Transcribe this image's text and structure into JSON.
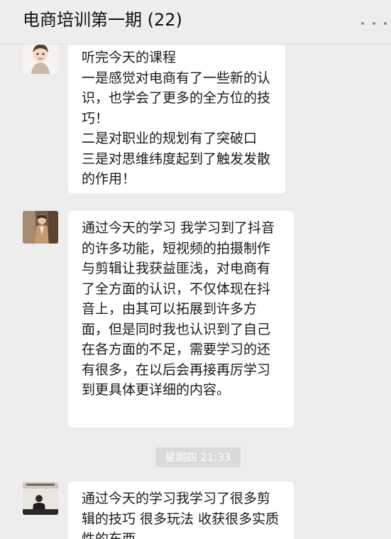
{
  "header": {
    "title": "电商培训第一期 (22)",
    "more_icon": "more-dots-icon"
  },
  "messages": [
    {
      "avatar": "avatar-cartoon-person",
      "text": "听完今天的课程\n一是感觉对电商有了一些新的认识，也学会了更多的全方位的技巧！\n二是对职业的规划有了突破口\n三是对思维纬度起到了触发发散的作用！"
    },
    {
      "avatar": "avatar-brown-coat-person",
      "text": "通过今天的学习  我学习到了抖音的许多功能，短视频的拍摄制作与剪辑让我获益匪浅，对电商有了全方面的认识，不仅体现在抖音上，由其可以拓展到许多方面，但是同时我也认识到了自己在各方面的不足，需要学习的还有很多，在以后会再接再厉学习到更具体更详细的内容。"
    },
    {
      "avatar": "avatar-person-at-desk",
      "text": "通过今天的学习我学习了很多剪辑的技巧 很多玩法 收获很多实质性的东西"
    }
  ],
  "timestamp": "星期四 21:33",
  "colors": {
    "background": "#ededed",
    "bubble": "#ffffff",
    "timestamp_bg": "#dadada"
  }
}
